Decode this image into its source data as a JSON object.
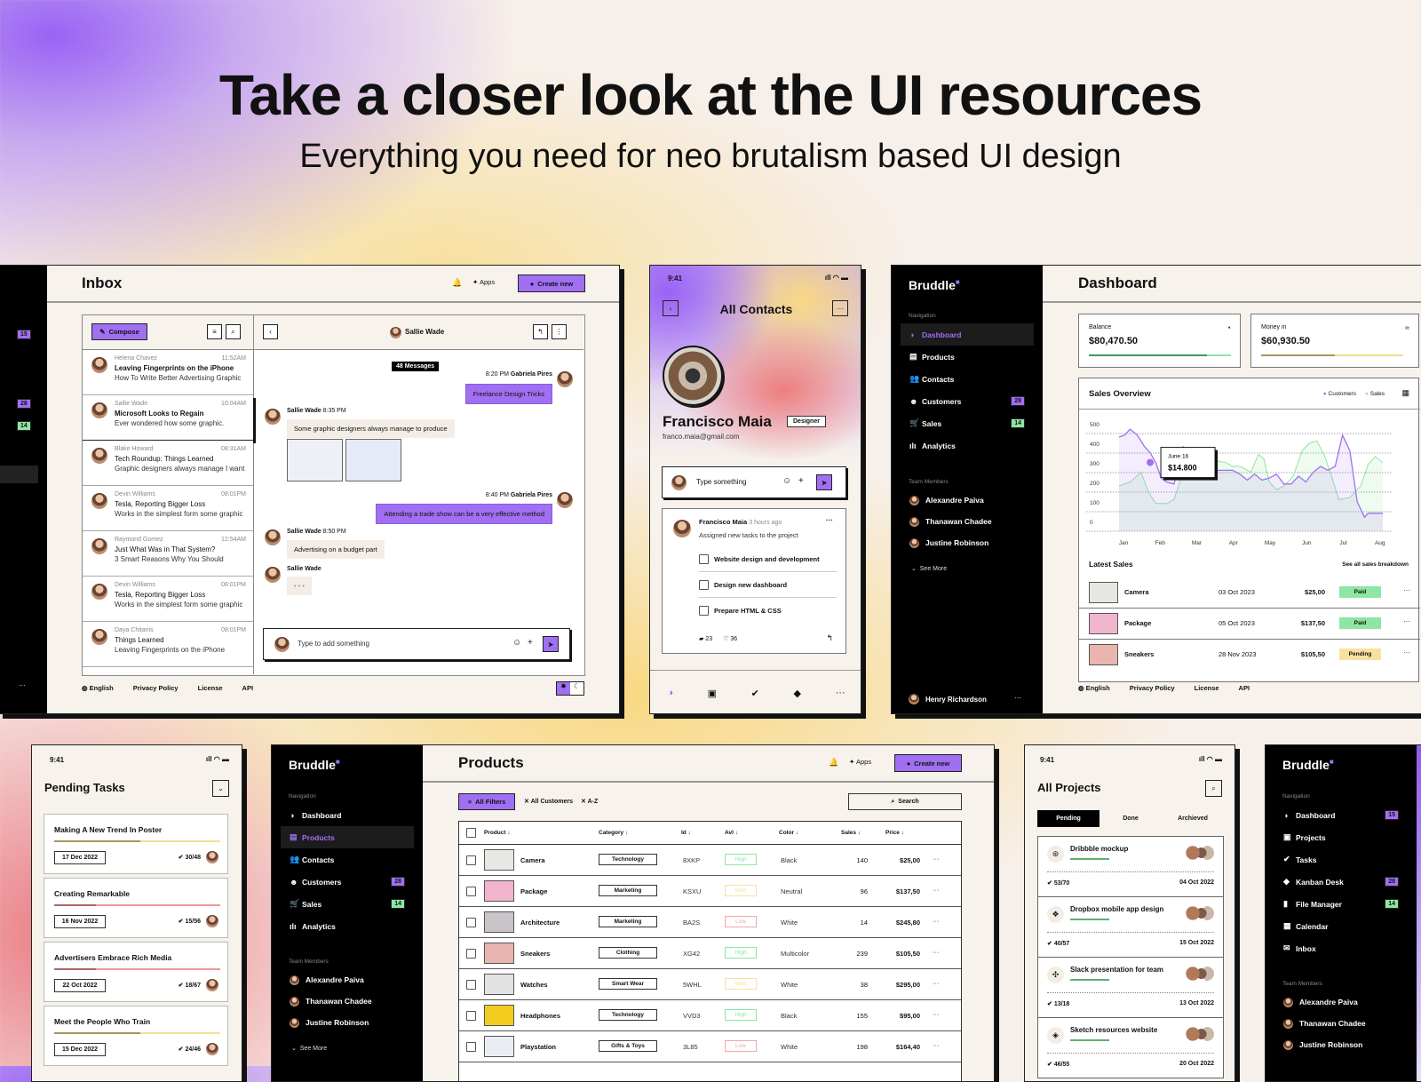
{
  "hero": {
    "title": "Take a closer look at the UI resources",
    "subtitle": "Everything you need for neo brutalism based UI design"
  },
  "colors": {
    "accent": "#a06ff2",
    "green": "#8ee6a2",
    "yellow": "#f8e0a0",
    "dark": "#000000",
    "paper": "#f7f2ec"
  },
  "inbox": {
    "left_badges": [
      "15",
      "28",
      "14"
    ],
    "title": "Inbox",
    "apps_label": "Apps",
    "create_label": "Create new",
    "compose_label": "Compose",
    "thread_name": "Sallie Wade",
    "messages_count": "48 Messages",
    "mails": [
      {
        "from": "Helena Chavez",
        "time": "11:52AM",
        "subject": "Leaving Fingerprints on the iPhone",
        "preview": "How To Write Better Advertising Graphic",
        "bold": true
      },
      {
        "from": "Sallie Wade",
        "time": "10:04AM",
        "subject": "Microsoft Looks to Regain",
        "preview": "Ever wondered how some graphic.",
        "bold": true
      },
      {
        "from": "Blake Howard",
        "time": "08:31AM",
        "subject": "Tech Roundup: Things Learned",
        "preview": "Graphic designers always manage I want",
        "bold": false
      },
      {
        "from": "Devin Williams",
        "time": "08:01PM",
        "subject": "Tesla, Reporting Bigger Loss",
        "preview": "Works in the simplest form some graphic",
        "bold": false
      },
      {
        "from": "Raymond Gomez",
        "time": "12:54AM",
        "subject": "Just What Was in That System?",
        "preview": "3 Smart Reasons Why You Should",
        "bold": false
      },
      {
        "from": "Devin Williams",
        "time": "08:01PM",
        "subject": "Tesla, Reporting Bigger Loss",
        "preview": "Works in the simplest form some graphic",
        "bold": false
      },
      {
        "from": "Daya Chitanis",
        "time": "08:01PM",
        "subject": "Things Learned",
        "preview": "Leaving Fingerprints on the iPhone",
        "bold": false
      }
    ],
    "chat": [
      {
        "time": "8:20 PM",
        "name": "Gabriela Pires",
        "text": "Freelance Design Tricks"
      },
      {
        "time": "8:35 PM",
        "name": "Sallie Wade",
        "text": "Some graphic designers always manage to produce"
      },
      {
        "time": "8:40 PM",
        "name": "Gabriela Pires",
        "text": "Attending a trade show can be a very effective method"
      },
      {
        "time": "8:50 PM",
        "name": "Sallie Wade",
        "text": "Advertising on a budget part"
      },
      {
        "time": "",
        "name": "Sallie Wade",
        "text": "• • •"
      }
    ],
    "input_placeholder": "Type to add something",
    "footer": {
      "language": "English",
      "privacy": "Privacy Policy",
      "license": "License",
      "api": "API"
    }
  },
  "contact": {
    "time": "9:41",
    "title": "All Contacts",
    "name": "Francisco Maia",
    "role": "Designer",
    "email": "franco.maia@gmail.com",
    "input_placeholder": "Type something",
    "post": {
      "author": "Francisco Maia",
      "ago": "3 hours ago",
      "text": "Assigned new tasks to the project",
      "tasks": [
        "Website design and development",
        "Design new dashboard",
        "Prepare HTML & CSS"
      ],
      "comments": "23",
      "likes": "36"
    }
  },
  "dashboard": {
    "brand": "Bruddle",
    "nav_header": "Navigation",
    "nav": [
      {
        "label": "Dashboard",
        "icon": "◑",
        "badge": "",
        "active": true
      },
      {
        "label": "Products",
        "icon": "▤",
        "badge": ""
      },
      {
        "label": "Contacts",
        "icon": "👥",
        "badge": ""
      },
      {
        "label": "Customers",
        "icon": "☻",
        "badge": "28",
        "badge_color": "purple"
      },
      {
        "label": "Sales",
        "icon": "🛒",
        "badge": "14",
        "badge_color": "green"
      },
      {
        "label": "Analytics",
        "icon": "ılı",
        "badge": ""
      }
    ],
    "team_header": "Team Members",
    "team": [
      "Alexandre Paiva",
      "Thanawan Chadee",
      "Justine Robinson"
    ],
    "see_more": "See More",
    "user": "Henry Richardson",
    "title": "Dashboard",
    "balance_label": "Balance",
    "balance_value": "$80,470.50",
    "balance_progress": 0.83,
    "money_in_label": "Money in",
    "money_in_value": "$60,930.50",
    "money_in_progress": 0.52,
    "latest_sales_title": "Latest Sales",
    "see_all": "See all sales breakdown",
    "sales": [
      {
        "name": "Camera",
        "date": "03 Oct 2023",
        "price": "$25,00",
        "status": "Paid"
      },
      {
        "name": "Package",
        "date": "05 Oct 2023",
        "price": "$137,50",
        "status": "Paid"
      },
      {
        "name": "Sneakers",
        "date": "28 Nov 2023",
        "price": "$105,50",
        "status": "Pending"
      }
    ],
    "footer": {
      "language": "English",
      "privacy": "Privacy Policy",
      "license": "License",
      "api": "API"
    }
  },
  "chart_data": {
    "type": "line",
    "title": "Sales Overview",
    "xlabel": "",
    "ylabel": "",
    "categories": [
      "Jan",
      "Feb",
      "Mar",
      "Apr",
      "May",
      "Jun",
      "Jul",
      "Aug"
    ],
    "ylim": [
      0,
      500
    ],
    "yticks": [
      0,
      100,
      200,
      300,
      400,
      500
    ],
    "grid": true,
    "legend": "top-right",
    "tooltip": {
      "label": "June 16",
      "value": "$14.800"
    },
    "series": [
      {
        "name": "Customers",
        "color": "#a06ff2",
        "x": [
          0,
          0.15,
          0.3,
          0.5,
          0.7,
          0.85,
          1.0,
          1.15,
          1.3,
          1.5,
          1.75,
          1.9,
          2.1,
          2.3,
          2.5,
          2.7,
          2.9,
          3.1,
          3.3,
          3.5,
          3.7,
          3.9,
          4.1,
          4.3,
          4.5,
          4.7,
          4.9,
          5.1,
          5.3,
          5.5,
          5.7,
          5.9,
          6.1,
          6.3,
          6.5,
          6.7,
          6.8,
          6.95,
          7.05,
          7.2
        ],
        "values": [
          450,
          460,
          490,
          460,
          400,
          370,
          320,
          240,
          220,
          210,
          400,
          370,
          360,
          380,
          280,
          280,
          280,
          280,
          260,
          230,
          260,
          230,
          240,
          260,
          210,
          210,
          250,
          220,
          270,
          300,
          280,
          300,
          460,
          380,
          120,
          40,
          60,
          60,
          60,
          60
        ]
      },
      {
        "name": "Sales",
        "color": "#8ee6a2",
        "x": [
          0,
          0.3,
          0.6,
          0.8,
          1.0,
          1.3,
          1.5,
          1.8,
          2.0,
          2.3,
          2.6,
          2.9,
          3.1,
          3.3,
          3.6,
          3.8,
          3.95,
          4.1,
          4.3,
          4.5,
          4.75,
          5.0,
          5.2,
          5.4,
          5.6,
          5.8,
          6.0,
          6.3,
          6.6,
          6.8,
          7.0,
          7.2
        ],
        "values": [
          200,
          220,
          270,
          170,
          110,
          110,
          130,
          300,
          340,
          350,
          330,
          320,
          300,
          300,
          270,
          360,
          340,
          220,
          180,
          200,
          250,
          380,
          420,
          430,
          360,
          250,
          130,
          140,
          200,
          310,
          350,
          320
        ]
      }
    ]
  },
  "pending": {
    "time": "9:41",
    "title": "Pending Tasks",
    "tasks": [
      {
        "title": "Making A New Trend In Poster",
        "date": "17 Dec 2022",
        "count": "30/48",
        "progress": 0.52,
        "tone": "yellow"
      },
      {
        "title": "Creating Remarkable",
        "date": "16 Nov 2022",
        "count": "15/56",
        "progress": 0.25,
        "tone": "red"
      },
      {
        "title": "Advertisers Embrace Rich Media",
        "date": "22 Oct 2022",
        "count": "18/67",
        "progress": 0.25,
        "tone": "red"
      },
      {
        "title": "Meet the People Who Train",
        "date": "15 Dec 2022",
        "count": "24/46",
        "progress": 0.52,
        "tone": "yellow"
      }
    ]
  },
  "products": {
    "brand": "Bruddle",
    "nav_header": "Navigation",
    "nav": [
      {
        "label": "Dashboard",
        "icon": "◑",
        "badge": ""
      },
      {
        "label": "Products",
        "icon": "▤",
        "badge": "",
        "active": true
      },
      {
        "label": "Contacts",
        "icon": "👥",
        "badge": ""
      },
      {
        "label": "Customers",
        "icon": "☻",
        "badge": "28",
        "badge_color": "purple"
      },
      {
        "label": "Sales",
        "icon": "🛒",
        "badge": "14",
        "badge_color": "green"
      },
      {
        "label": "Analytics",
        "icon": "ılı",
        "badge": ""
      }
    ],
    "team_header": "Team Members",
    "team": [
      "Alexandre Paiva",
      "Thanawan Chadee",
      "Justine Robinson"
    ],
    "see_more": "See More",
    "title": "Products",
    "apps_label": "Apps",
    "create_label": "Create new",
    "filters_label": "All Filters",
    "chips": [
      "All Customers",
      "A-Z"
    ],
    "search_label": "Search",
    "columns": [
      "Product",
      "Category",
      "Id",
      "Avl",
      "Color",
      "Sales",
      "Price"
    ],
    "rows": [
      {
        "name": "Camera",
        "category": "Technology",
        "id": "8XKP",
        "avl": "High",
        "color": "Black",
        "sales": "140",
        "price": "$25,00"
      },
      {
        "name": "Package",
        "category": "Marketing",
        "id": "KSXU",
        "avl": "Med",
        "color": "Neutral",
        "sales": "96",
        "price": "$137,50"
      },
      {
        "name": "Architecture",
        "category": "Marketing",
        "id": "BA2S",
        "avl": "Low",
        "color": "White",
        "sales": "14",
        "price": "$245,80"
      },
      {
        "name": "Sneakers",
        "category": "Clothing",
        "id": "XG42",
        "avl": "High",
        "color": "Multicolor",
        "sales": "239",
        "price": "$105,50"
      },
      {
        "name": "Watches",
        "category": "Smart Wear",
        "id": "5WHL",
        "avl": "Med",
        "color": "White",
        "sales": "38",
        "price": "$295,00"
      },
      {
        "name": "Headphones",
        "category": "Technology",
        "id": "VVD3",
        "avl": "High",
        "color": "Black",
        "sales": "155",
        "price": "$95,00"
      },
      {
        "name": "Playstation",
        "category": "Gifts & Toys",
        "id": "3L85",
        "avl": "Low",
        "color": "White",
        "sales": "198",
        "price": "$164,40"
      }
    ]
  },
  "projects": {
    "time": "9:41",
    "title": "All Projects",
    "tabs": [
      "Pending",
      "Done",
      "Archieved"
    ],
    "items": [
      {
        "name": "Dribbble mockup",
        "icon": "⊛",
        "count": "53/70",
        "date": "04 Oct 2022"
      },
      {
        "name": "Dropbox mobile app design",
        "icon": "❖",
        "count": "40/57",
        "date": "15 Oct 2022"
      },
      {
        "name": "Slack presentation for team",
        "icon": "✣",
        "count": "13/18",
        "date": "13 Oct 2022"
      },
      {
        "name": "Sketch resources website",
        "icon": "◈",
        "count": "46/55",
        "date": "20 Oct 2022"
      }
    ]
  },
  "side4": {
    "brand": "Bruddle",
    "nav_header": "Navigation",
    "nav": [
      {
        "label": "Dashboard",
        "icon": "◑",
        "badge": "15",
        "badge_color": "purple"
      },
      {
        "label": "Projects",
        "icon": "▣",
        "badge": ""
      },
      {
        "label": "Tasks",
        "icon": "✔",
        "badge": ""
      },
      {
        "label": "Kanban Desk",
        "icon": "◆",
        "badge": "28",
        "badge_color": "purple"
      },
      {
        "label": "File Manager",
        "icon": "▮",
        "badge": "14",
        "badge_color": "green"
      },
      {
        "label": "Calendar",
        "icon": "▦",
        "badge": ""
      },
      {
        "label": "Inbox",
        "icon": "✉",
        "badge": ""
      }
    ],
    "team_header": "Team Members",
    "team": [
      "Alexandre Paiva",
      "Thanawan Chadee",
      "Justine Robinson"
    ]
  }
}
